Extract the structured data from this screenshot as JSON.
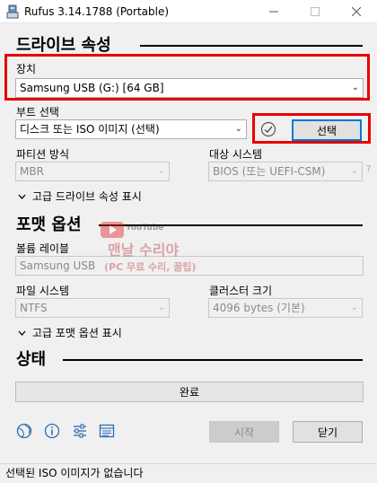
{
  "window": {
    "title": "Rufus 3.14.1788 (Portable)",
    "minimize_icon": "minimize-icon",
    "maximize_icon": "maximize-icon",
    "close_icon": "close-icon"
  },
  "drive_section": {
    "title": "드라이브 속성",
    "device_label": "장치",
    "device_value": "Samsung USB (G:) [64 GB]",
    "boot_label": "부트 선택",
    "boot_value": "디스크 또는 ISO 이미지 (선택)",
    "select_button": "선택",
    "partition_label": "파티션 방식",
    "partition_value": "MBR",
    "target_label": "대상 시스템",
    "target_value": "BIOS (또는 UEFI-CSM)",
    "help_mark": "?",
    "advanced_toggle": "고급 드라이브 속성 표시"
  },
  "format_section": {
    "title": "포맷 옵션",
    "volume_label": "볼륨 레이블",
    "volume_value": "Samsung USB",
    "fs_label": "파일 시스템",
    "fs_value": "NTFS",
    "cluster_label": "클러스터 크기",
    "cluster_value": "4096 bytes (기본)",
    "advanced_toggle": "고급 포맷 옵션 표시"
  },
  "status_section": {
    "title": "상태",
    "progress_text": "완료",
    "progress_fraction": 0
  },
  "toolbar": {
    "language_icon": "globe-icon",
    "about_icon": "info-icon",
    "settings_icon": "sliders-icon",
    "log_icon": "log-icon",
    "start_button": "시작",
    "close_button": "닫기"
  },
  "statusbar": {
    "text": "선택된 ISO 이미지가 없습니다"
  },
  "watermark": {
    "brand": "YouTube",
    "title": "맨날 수리야",
    "subtitle": "(PC 무료 수리, 꿀팁)"
  },
  "colors": {
    "highlight": "#e60000",
    "accent": "#0078d7",
    "window_bg": "#f0f0f0"
  }
}
